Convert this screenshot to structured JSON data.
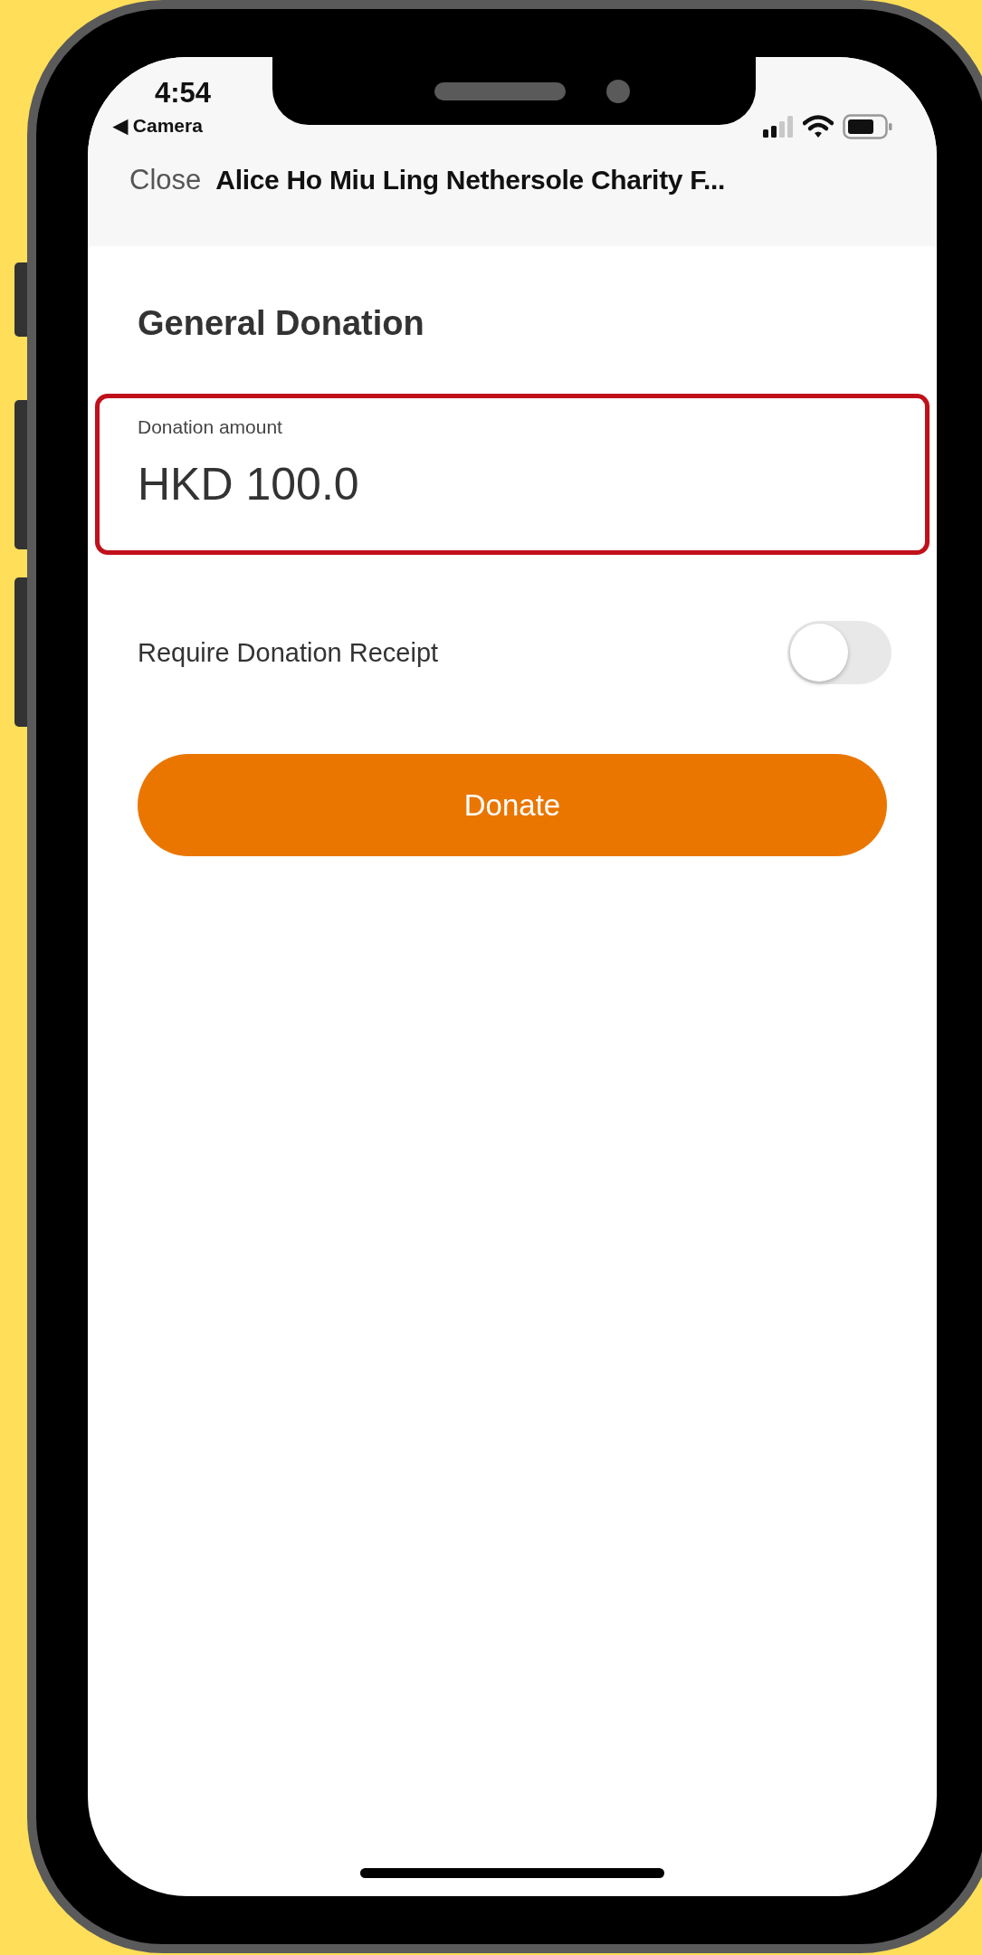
{
  "status_bar": {
    "time": "4:54",
    "back_app": "◀ Camera"
  },
  "nav_bar": {
    "close": "Close",
    "title": "Alice Ho Miu Ling Nethersole Charity F..."
  },
  "heading": "General Donation",
  "amount_field": {
    "label": "Donation amount",
    "value": "HKD 100.0",
    "highlighted": true
  },
  "receipt_toggle": {
    "label": "Require Donation Receipt",
    "on": false
  },
  "donate_button": "Donate"
}
